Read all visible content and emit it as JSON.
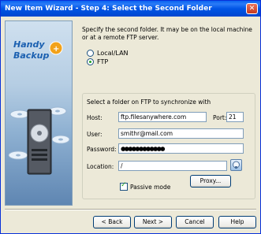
{
  "window": {
    "title": "New Item Wizard - Step 4: Select the Second Folder",
    "close": "✕"
  },
  "banner": {
    "logo_line1": "Handy",
    "logo_line2": "Backup"
  },
  "description": "Specify the second folder. It may be on the local machine or at a remote FTP server.",
  "radios": [
    {
      "label": "Local/LAN",
      "checked": false
    },
    {
      "label": "FTP",
      "checked": true
    }
  ],
  "ftp": {
    "group_title": "Select a folder on FTP to synchronize with",
    "host_label": "Host:",
    "host_value": "ftp.filesanywhere.com",
    "port_label": "Port:",
    "port_value": "21",
    "user_label": "User:",
    "user_value": "smithr@mail.com",
    "password_label": "Password:",
    "password_value": "●●●●●●●●●●●●",
    "location_label": "Location:",
    "location_value": "/",
    "passive_label": "Passive mode",
    "passive_checked": true,
    "proxy_label": "Proxy..."
  },
  "buttons": {
    "back": "< Back",
    "next": "Next >",
    "cancel": "Cancel",
    "help": "Help"
  }
}
